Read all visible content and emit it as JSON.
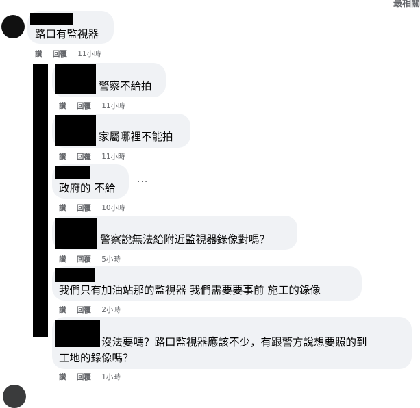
{
  "header": {
    "sort_label": "最相關"
  },
  "comments": [
    {
      "text": "路口有監視器",
      "like": "讚",
      "reply": "回覆",
      "time": "11小時"
    },
    {
      "text": "警察不給拍",
      "like": "讚",
      "reply": "回覆",
      "time": "11小時"
    },
    {
      "text": "家屬哪裡不能拍",
      "like": "讚",
      "reply": "回覆",
      "time": "11小時"
    },
    {
      "text": "政府的 不給",
      "like": "讚",
      "reply": "回覆",
      "time": "10小時",
      "more": "···"
    },
    {
      "text": "警察說無法給附近監視器錄像對嗎？",
      "like": "讚",
      "reply": "回覆",
      "time": "5小時"
    },
    {
      "text": "我們只有加油站那的監視器 我們需要要事前 施工的錄像",
      "like": "讚",
      "reply": "回覆",
      "time": "2小時"
    },
    {
      "text_line1": "沒法要嗎？路口監視器應該不少，有跟警方說想要照的到",
      "text_line2": "工地的錄像嗎？",
      "like": "讚",
      "reply": "回覆",
      "time": "1小時"
    }
  ]
}
